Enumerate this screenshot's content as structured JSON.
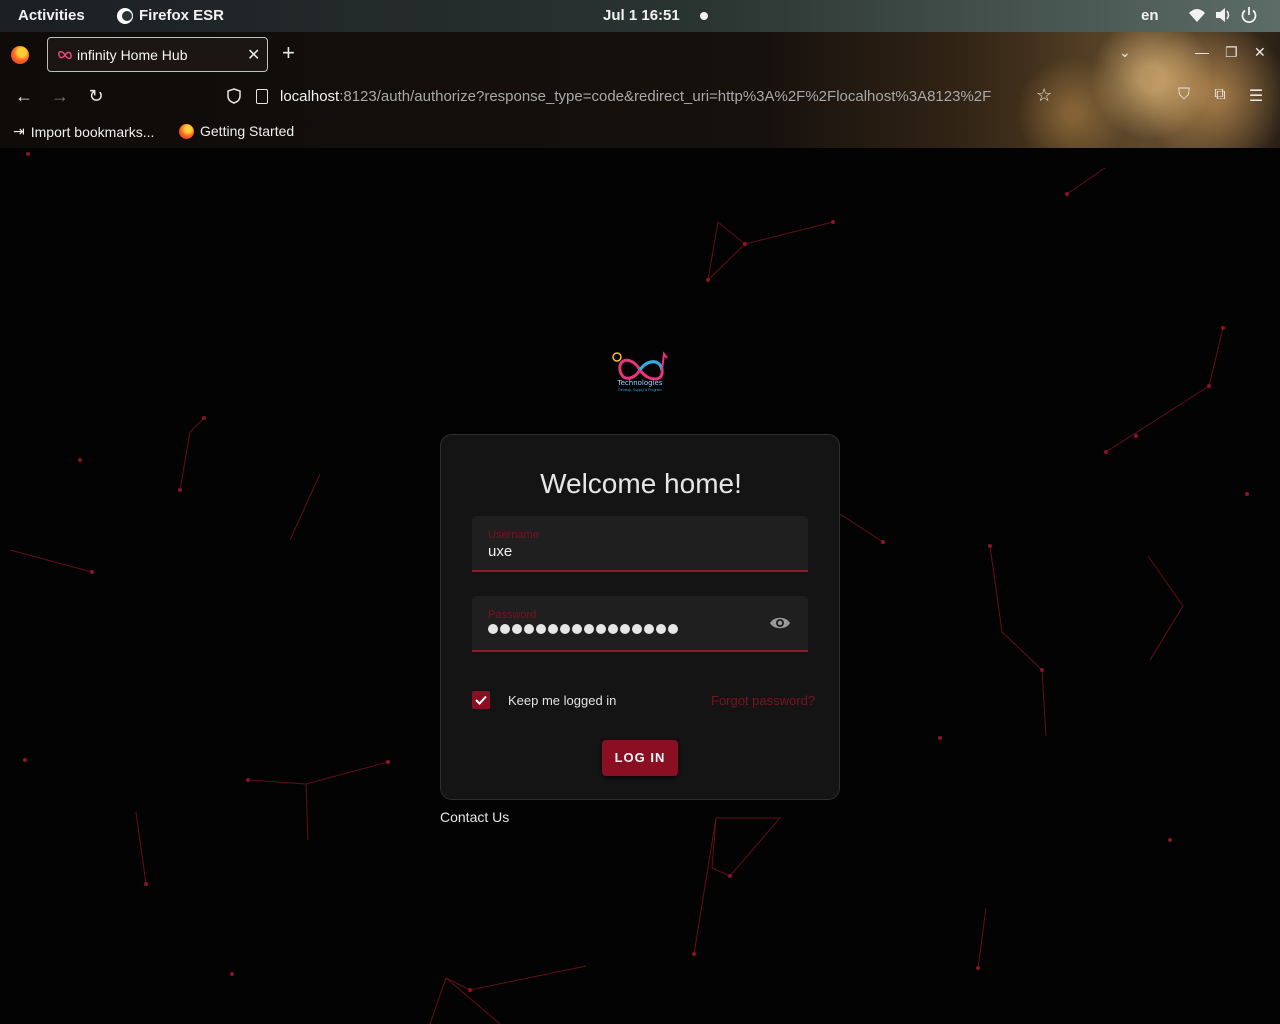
{
  "system": {
    "activities": "Activities",
    "app_name": "Firefox ESR",
    "clock": "Jul 1  16:51",
    "language": "en"
  },
  "browser": {
    "tab_title": "infinity Home Hub",
    "url_host": "localhost",
    "url_rest": ":8123/auth/authorize?response_type=code&redirect_uri=http%3A%2F%2Flocalhost%3A8123%2F",
    "bookmarks": [
      {
        "label": "Import bookmarks..."
      },
      {
        "label": "Getting Started"
      }
    ]
  },
  "logo": {
    "text": "Technologies",
    "tagline": "Develop, Supply & Program"
  },
  "login": {
    "heading": "Welcome home!",
    "username_label": "Username",
    "username_value": "uxe",
    "password_label": "Password",
    "password_length": 16,
    "keep_logged_in_label": "Keep me logged in",
    "keep_logged_in_checked": true,
    "forgot_password": "Forgot password?",
    "submit_label": "LOG IN",
    "contact": "Contact Us"
  },
  "colors": {
    "accent": "#8b0f22",
    "background": "#030303",
    "card": "#141414"
  }
}
